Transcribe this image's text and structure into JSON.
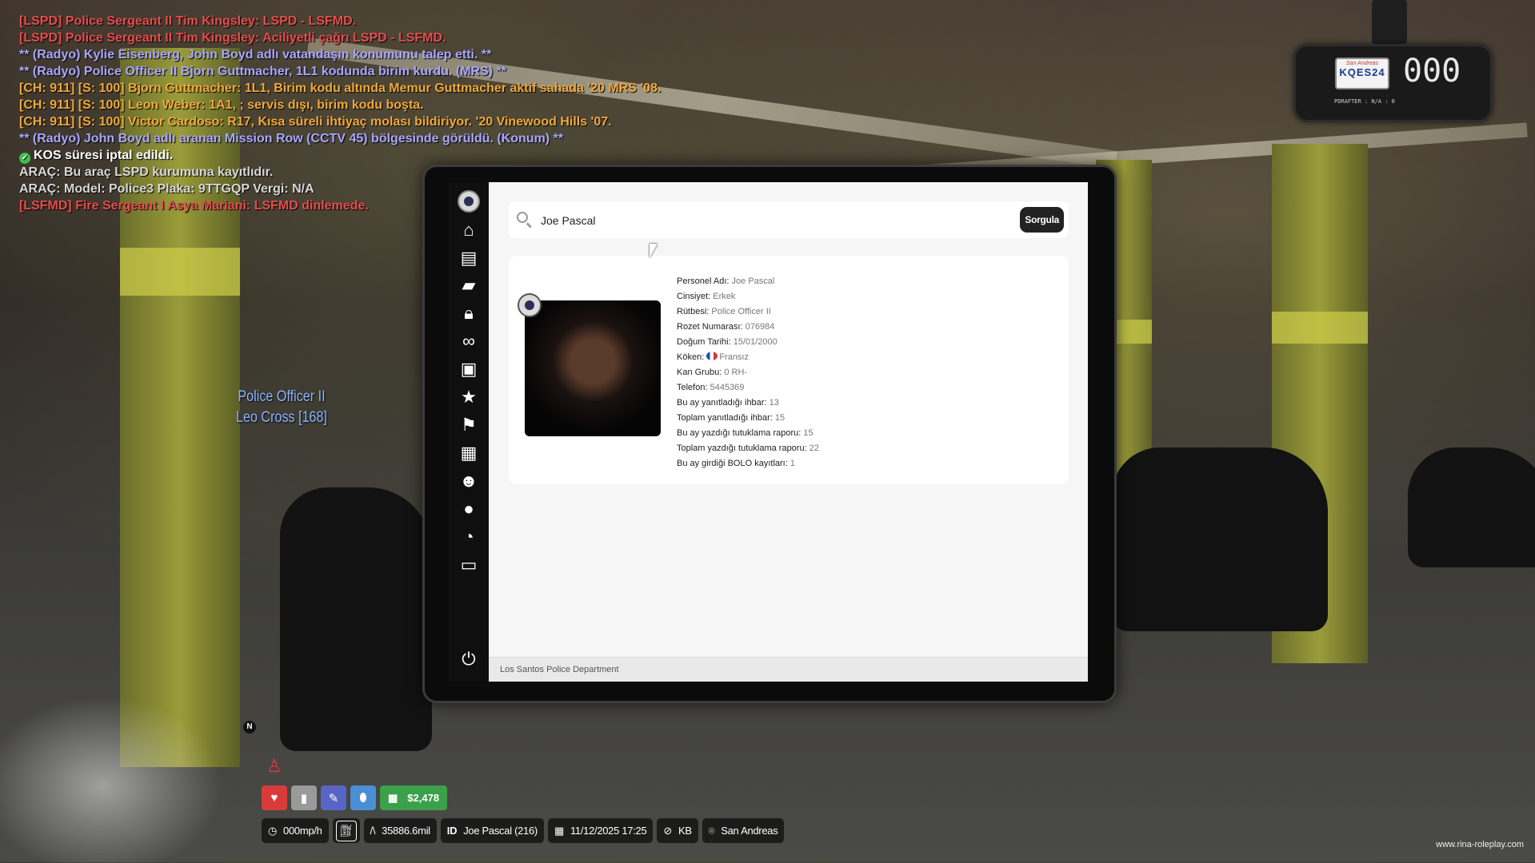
{
  "chat": [
    {
      "color": "red",
      "text": "[LSPD] Police Sergeant II Tim Kingsley: LSPD - LSFMD."
    },
    {
      "color": "red",
      "text": "[LSPD] Police Sergeant II Tim Kingsley: Aciliyetli çağrı LSPD - LSFMD."
    },
    {
      "color": "violet",
      "text": "** (Radyo) Kylie Eisenberg, John Boyd adlı vatandaşın konumunu talep etti. **"
    },
    {
      "color": "violet",
      "text": "** (Radyo) Police Officer II Bjorn Guttmacher, 1L1 kodunda birim kurdu. (MRS) **"
    },
    {
      "color": "orange",
      "text": "[CH: 911] [S: 100] Bjorn Guttmacher: 1L1, Birim kodu altında Memur Guttmacher aktif sahada '20 MRS '08."
    },
    {
      "color": "orange",
      "text": "[CH: 911] [S: 100] Leon Weber: 1A1, ; servis dışı, birim kodu boşta."
    },
    {
      "color": "orange",
      "text": "[CH: 911] [S: 100] Victor Cardoso: R17, Kısa süreli ihtiyaç molası bildiriyor. '20 Vinewood Hills '07."
    },
    {
      "color": "violet",
      "text": "** (Radyo) John Boyd adlı aranan Mission Row (CCTV 45) bölgesinde görüldü. (Konum) **"
    },
    {
      "color": "white",
      "text": "KOS süresi iptal edildi.",
      "icon": true
    },
    {
      "color": "grey",
      "text": "ARAÇ: Bu araç LSPD kurumuna kayıtlıdır."
    },
    {
      "color": "grey",
      "text": "ARAÇ: Model: Police3 Plaka: 9TTGQP Vergi: N/A"
    },
    {
      "color": "red",
      "text": "[LSFMD] Fire Sergeant I Asya Mariani: LSFMD dinlemede."
    }
  ],
  "nametag": {
    "line1": "Police Officer II",
    "line2": "Leo Cross [168]"
  },
  "radar": {
    "plate_state": "San Andreas",
    "plate": "KQES24",
    "speed": "000",
    "sub": "PDRAFTER : N/A : 0"
  },
  "search": {
    "value": "Joe Pascal",
    "button": "Sorgula"
  },
  "profile": {
    "fields": [
      {
        "label": "Personel Adı:",
        "value": "Joe Pascal"
      },
      {
        "label": "Cinsiyet:",
        "value": "Erkek"
      },
      {
        "label": "Rütbesi:",
        "value": "Police Officer II"
      },
      {
        "label": "Rozet Numarası:",
        "value": "076984"
      },
      {
        "label": "Doğum Tarihi:",
        "value": "15/01/2000"
      },
      {
        "label": "Köken:",
        "value": "Fransız",
        "flag": "fr"
      },
      {
        "label": "Kan Grubu:",
        "value": "0 RH-"
      },
      {
        "label": "Telefon:",
        "value": "5445369"
      },
      {
        "label": "Bu ay yanıtladığı ihbar:",
        "value": "13"
      },
      {
        "label": "Toplam yanıtladığı ihbar:",
        "value": "15"
      },
      {
        "label": "Bu ay yazdığı tutuklama raporu:",
        "value": "15"
      },
      {
        "label": "Toplam yazdığı tutuklama raporu:",
        "value": "22"
      },
      {
        "label": "Bu ay girdiği BOLO kayıtları:",
        "value": "1"
      }
    ]
  },
  "footer": "Los Santos Police Department",
  "nav_icons": [
    "home-icon",
    "document-icon",
    "folder-icon",
    "lock-icon",
    "binoculars-icon",
    "briefcase-icon",
    "star-icon",
    "flag-icon",
    "clipboard-icon",
    "group-icon",
    "user-icon",
    "gauge-icon",
    "archive-icon"
  ],
  "hud": {
    "money": "$2,478",
    "speed": "000mp/h",
    "mileage": "35886.6mil",
    "id_label": "ID",
    "player": "Joe Pascal (216)",
    "datetime": "11/12/2025 17:25",
    "direction": "KB",
    "location": "San Andreas",
    "compass": "N"
  },
  "watermark": "www.rina-roleplay.com"
}
